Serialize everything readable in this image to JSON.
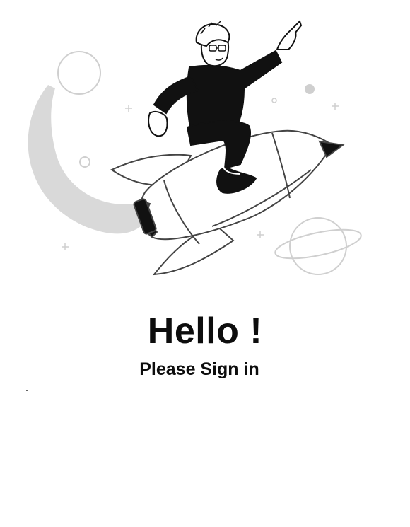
{
  "welcome": {
    "title": "Hello !",
    "subtitle": "Please Sign in"
  },
  "illustration": {
    "icon": "rocket-rider-illustration",
    "colors": {
      "ink": "#111111",
      "trail": "#d9d9d9",
      "outline": "#444444"
    }
  }
}
